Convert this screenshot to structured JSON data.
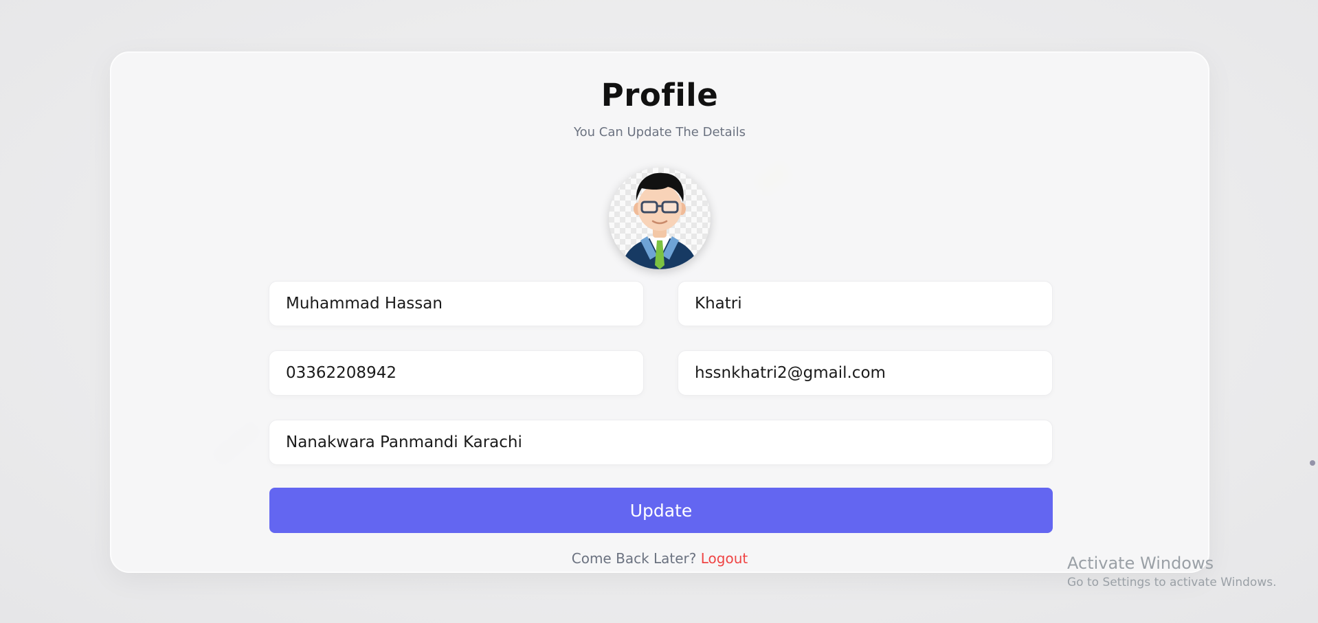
{
  "profile": {
    "title": "Profile",
    "subtitle": "You Can Update The Details",
    "avatar_alt": "User avatar"
  },
  "form": {
    "first_name": "Muhammad Hassan",
    "last_name": "Khatri",
    "phone": "03362208942",
    "email": "hssnkhatri2@gmail.com",
    "address": "Nanakwara Panmandi Karachi"
  },
  "actions": {
    "update_label": "Update",
    "footer_text": "Come Back Later?",
    "logout_label": "Logout"
  },
  "watermark": {
    "title": "Activate Windows",
    "subtitle": "Go to Settings to activate Windows."
  },
  "colors": {
    "accent": "#6366f1",
    "logout": "#ef4444"
  }
}
